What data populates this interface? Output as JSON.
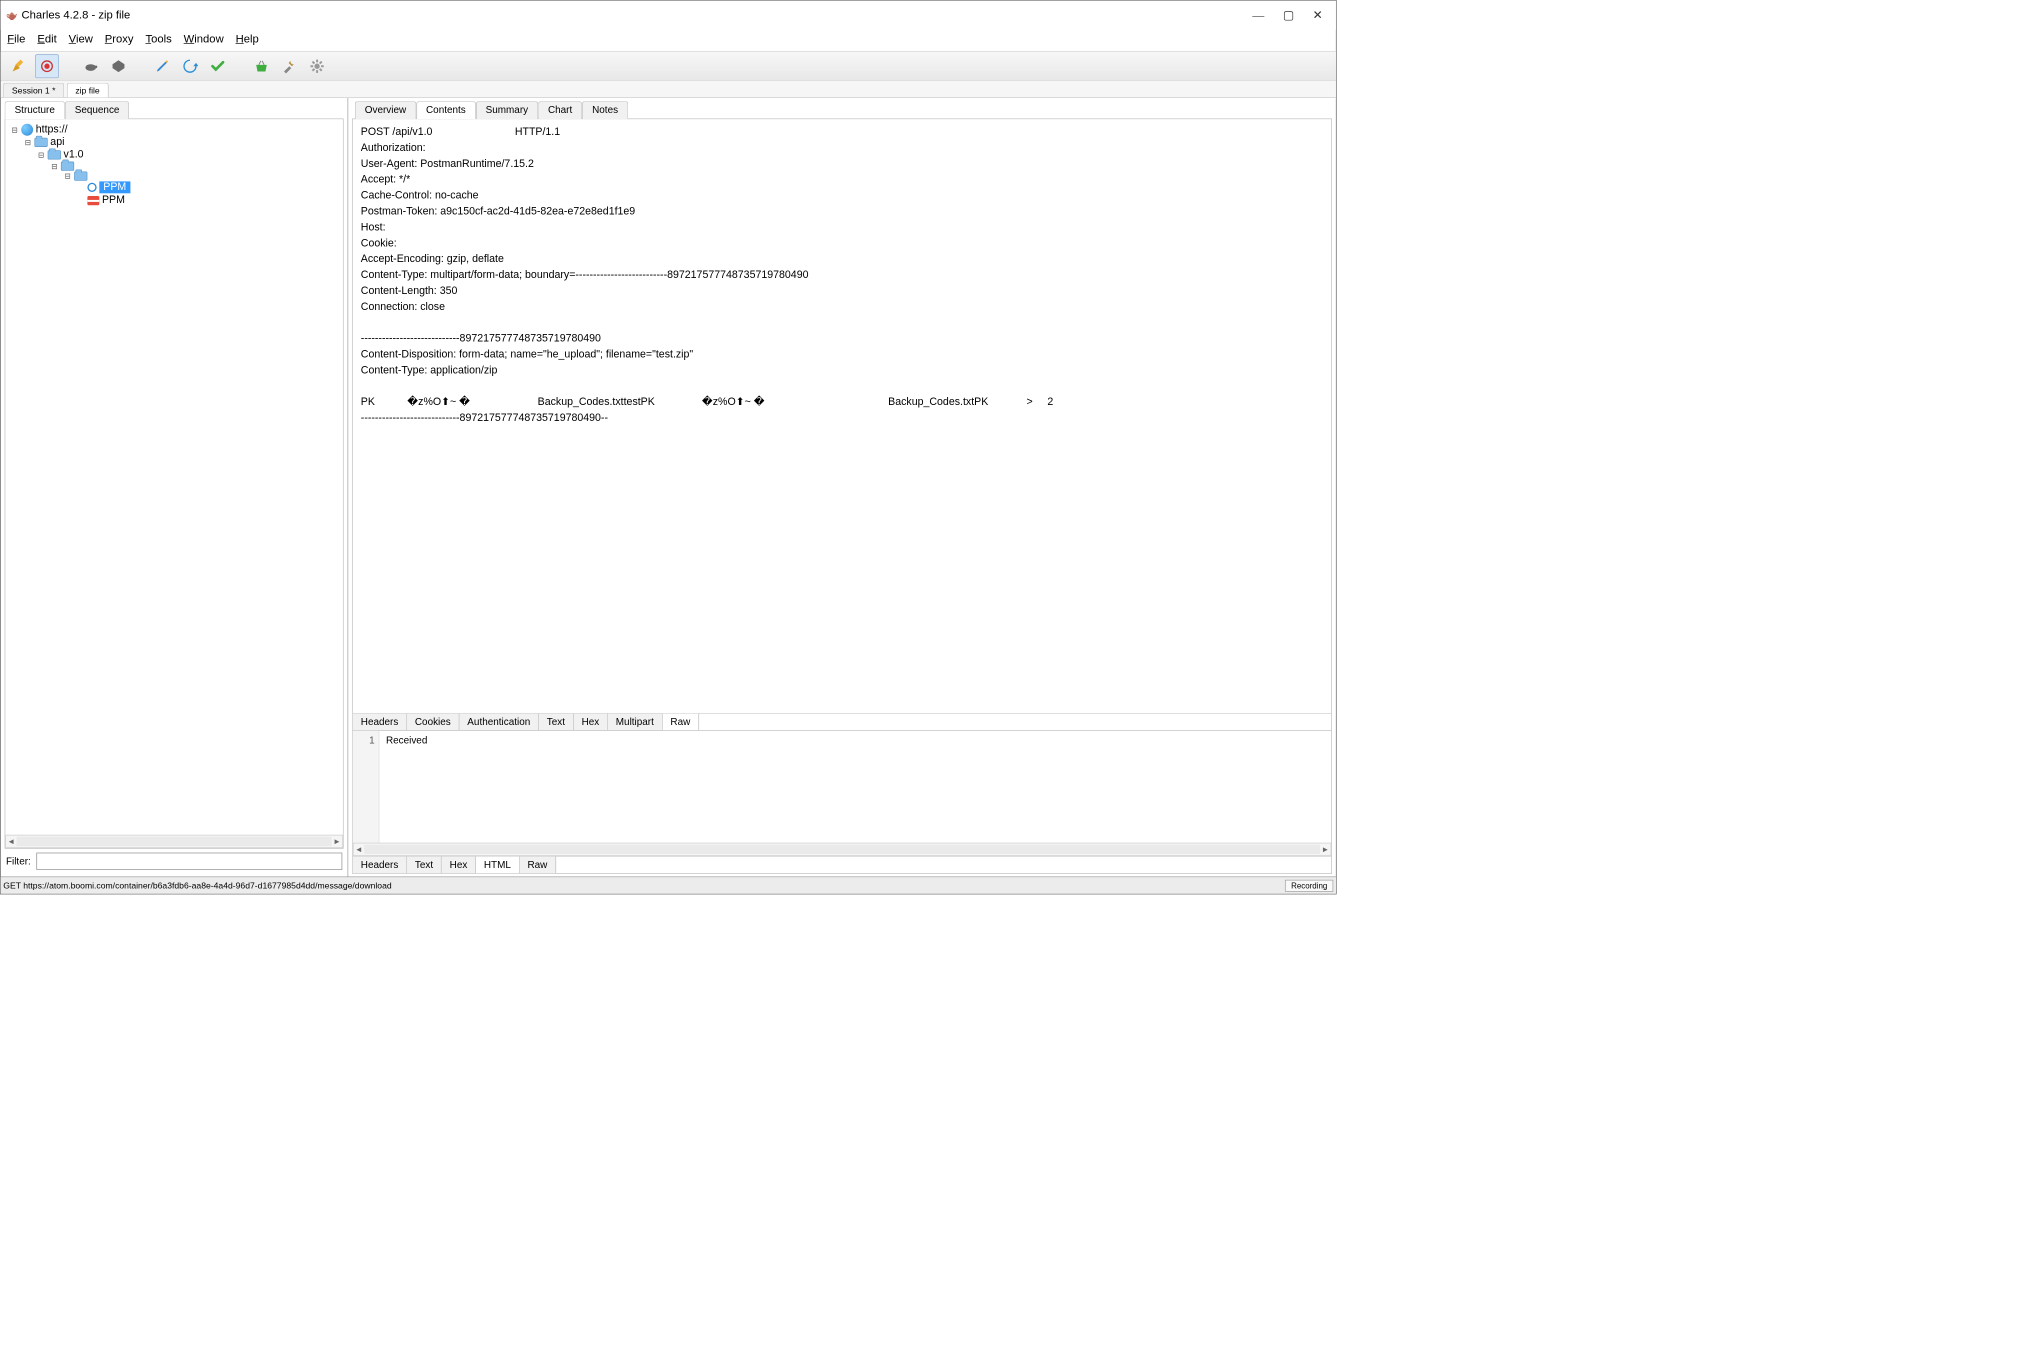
{
  "window": {
    "title": "Charles 4.2.8 - zip file"
  },
  "menus": [
    "File",
    "Edit",
    "View",
    "Proxy",
    "Tools",
    "Window",
    "Help"
  ],
  "session_tabs": [
    {
      "label": "Session 1 *",
      "active": false
    },
    {
      "label": "zip file",
      "active": true
    }
  ],
  "left": {
    "tabs": [
      "Structure",
      "Sequence"
    ],
    "active_tab": "Structure",
    "tree": {
      "root": "https://",
      "api": "api",
      "v10": "v1.0",
      "leaf_selected": "PPM",
      "leaf2": "PPM"
    },
    "filter_label": "Filter:"
  },
  "right": {
    "tabs": [
      "Overview",
      "Contents",
      "Summary",
      "Chart",
      "Notes"
    ],
    "active_tab": "Contents",
    "request_lines": [
      "POST /api/v1.0                            HTTP/1.1",
      "Authorization:",
      "User-Agent: PostmanRuntime/7.15.2",
      "Accept: */*",
      "Cache-Control: no-cache",
      "Postman-Token: a9c150cf-ac2d-41d5-82ea-e72e8ed1f1e9",
      "Host:",
      "Cookie:",
      "Accept-Encoding: gzip, deflate",
      "Content-Type: multipart/form-data; boundary=--------------------------897217577748735719780490",
      "Content-Length: 350",
      "Connection: close",
      "",
      "----------------------------897217577748735719780490",
      "Content-Disposition: form-data; name=\"he_upload\"; filename=\"test.zip\"",
      "Content-Type: application/zip",
      "",
      "PK           �z%O⬆~ �                       Backup_Codes.txttestPK                �z%O⬆~ �                                          Backup_Codes.txtPK             >     2",
      "----------------------------897217577748735719780490--"
    ],
    "req_tabs": [
      "Headers",
      "Cookies",
      "Authentication",
      "Text",
      "Hex",
      "Multipart",
      "Raw"
    ],
    "req_tab_active": "Raw",
    "response_line_num": "1",
    "response_body": "Received",
    "resp_tabs": [
      "Headers",
      "Text",
      "Hex",
      "HTML",
      "Raw"
    ],
    "resp_tab_active": "HTML"
  },
  "statusbar": {
    "text": "GET https://atom.boomi.com/container/b6a3fdb6-aa8e-4a4d-96d7-d1677985d4dd/message/download",
    "recording": "Recording"
  }
}
